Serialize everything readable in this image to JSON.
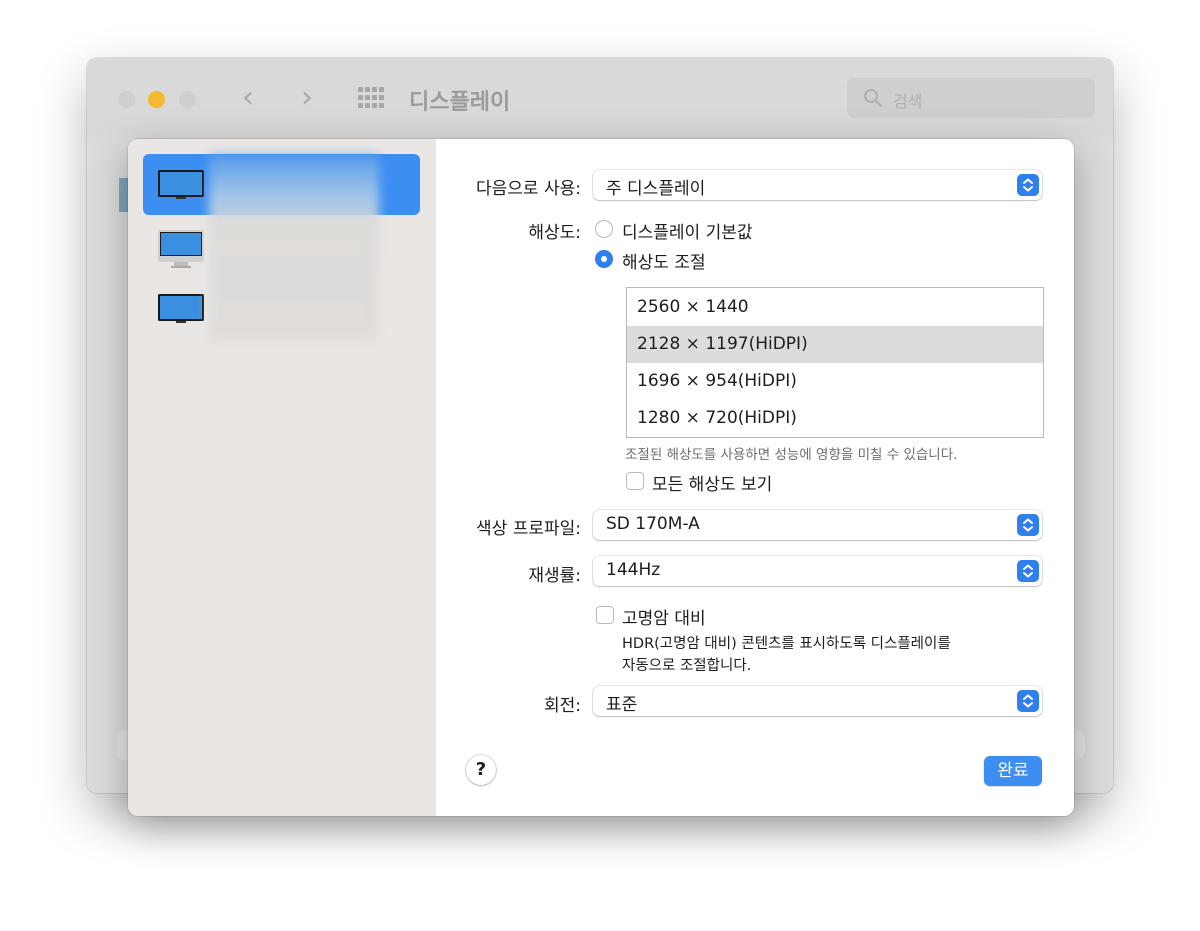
{
  "window": {
    "title": "디스플레이",
    "search_placeholder": "검색",
    "accent": "#3c8ff0"
  },
  "sidebar": {
    "items": [
      {
        "name": "",
        "icon": "monitor-icon",
        "selected": true
      },
      {
        "name": "",
        "icon": "imac-icon",
        "selected": false
      },
      {
        "name": "",
        "icon": "monitor-icon",
        "selected": false
      }
    ]
  },
  "main": {
    "use_as": {
      "label": "다음으로 사용:",
      "value": "주 디스플레이"
    },
    "resolution": {
      "label": "해상도:",
      "option_default": "디스플레이 기본값",
      "option_scaled": "해상도 조절",
      "selected_option": "해상도 조절",
      "list": [
        "2560 × 1440",
        "2128 × 1197(HiDPI)",
        "1696 × 954(HiDPI)",
        "1280 × 720(HiDPI)"
      ],
      "selected_row": "2128 × 1197(HiDPI)",
      "note": "조절된 해상도를 사용하면 성능에 영향을 미칠 수 있습니다.",
      "show_all": "모든 해상도 보기"
    },
    "color_profile": {
      "label": "색상 프로파일:",
      "value": "SD 170M-A"
    },
    "refresh_rate": {
      "label": "재생률:",
      "value": "144Hz"
    },
    "hdr": {
      "label": "고명암 대비",
      "desc_line1": "HDR(고명암 대비) 콘텐츠를 표시하도록 디스플레이를",
      "desc_line2": "자동으로 조절합니다."
    },
    "rotation": {
      "label": "회전:",
      "value": "표준"
    },
    "help": "?",
    "done": "완료"
  }
}
